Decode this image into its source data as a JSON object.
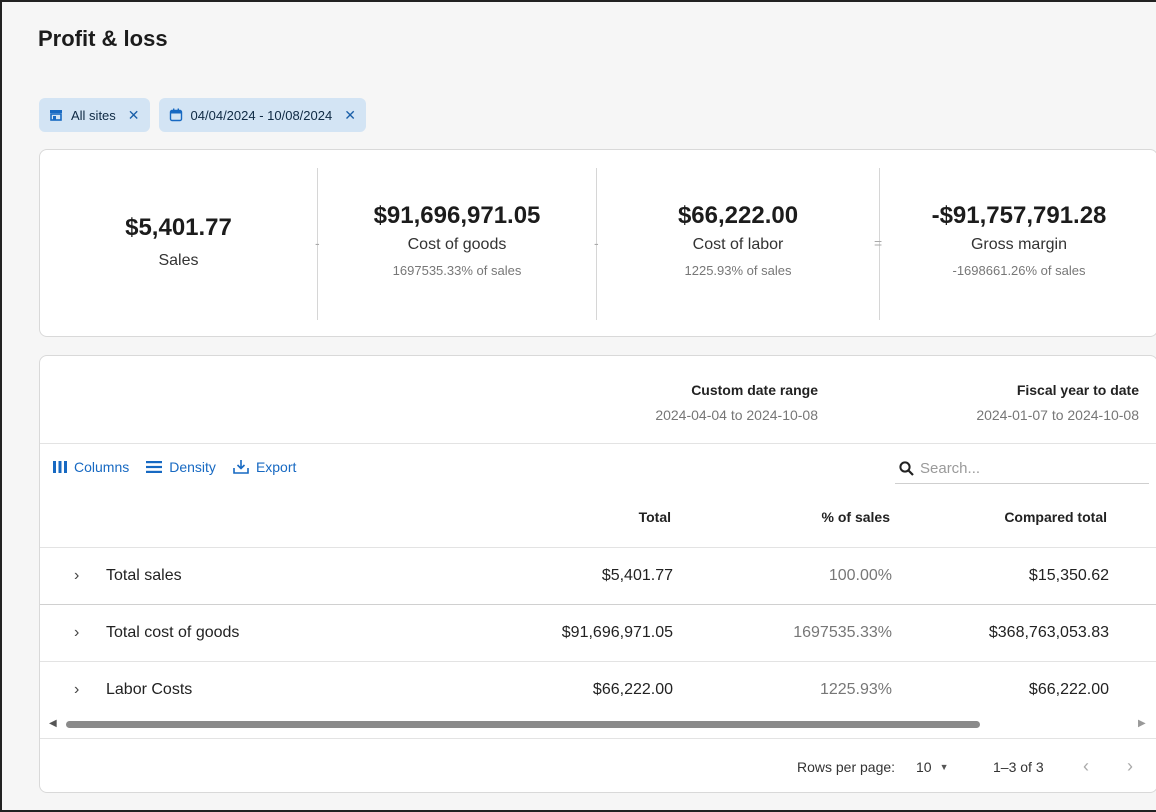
{
  "page": {
    "title": "Profit & loss"
  },
  "filters": [
    {
      "icon": "store-icon",
      "label": "All sites",
      "remove": "✕"
    },
    {
      "icon": "calendar-icon",
      "label": "04/04/2024 - 10/08/2024",
      "remove": "✕"
    }
  ],
  "summary": {
    "sales": {
      "value": "$5,401.77",
      "label": "Sales"
    },
    "op1": "-",
    "cost_of_goods": {
      "value": "$91,696,971.05",
      "label": "Cost of goods",
      "sub": "1697535.33% of sales"
    },
    "op2": "-",
    "cost_of_labor": {
      "value": "$66,222.00",
      "label": "Cost of labor",
      "sub": "1225.93% of sales"
    },
    "op3": "=",
    "gross_margin": {
      "value": "-$91,757,791.28",
      "label": "Gross margin",
      "sub": "-1698661.26% of sales"
    }
  },
  "ranges": [
    {
      "heading": "Custom date range",
      "dates": "2024-04-04 to 2024-10-08"
    },
    {
      "heading": "Fiscal year to date",
      "dates": "2024-01-07 to 2024-10-08"
    }
  ],
  "toolbar": {
    "columns": "Columns",
    "density": "Density",
    "export": "Export"
  },
  "search": {
    "placeholder": "Search..."
  },
  "table": {
    "headers": [
      "Total",
      "% of sales",
      "Compared total"
    ],
    "rows": [
      {
        "name": "Total sales",
        "total": "$5,401.77",
        "pct": "100.00%",
        "compared": "$15,350.62"
      },
      {
        "name": "Total cost of goods",
        "total": "$91,696,971.05",
        "pct": "1697535.33%",
        "compared": "$368,763,053.83"
      },
      {
        "name": "Labor Costs",
        "total": "$66,222.00",
        "pct": "1225.93%",
        "compared": "$66,222.00"
      }
    ]
  },
  "pagination": {
    "rows_per_page_label": "Rows per page:",
    "rows_per_page": "10",
    "count": "1–3 of 3"
  },
  "colors": {
    "accent": "#1769c2",
    "chip_bg": "#d3e4f4"
  }
}
